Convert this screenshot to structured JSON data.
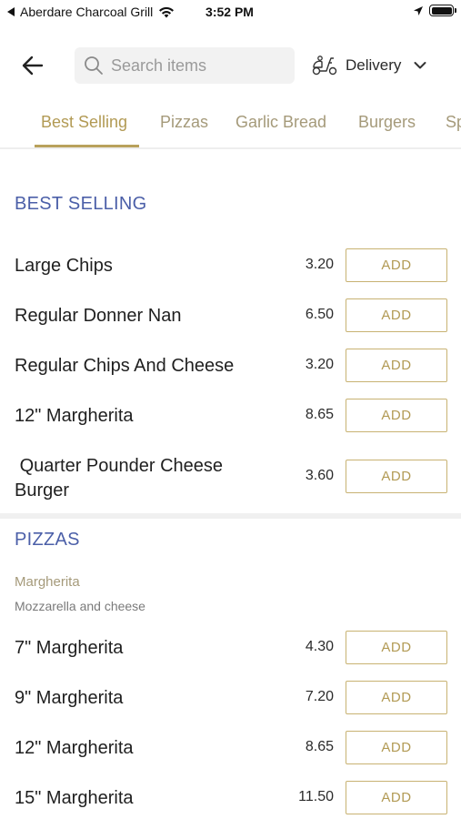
{
  "status_bar": {
    "carrier": "Aberdare Charcoal Grill",
    "time": "3:52 PM"
  },
  "header": {
    "search_placeholder": "Search items",
    "delivery_label": "Delivery"
  },
  "tabs": [
    {
      "label": "Best Selling",
      "active": true
    },
    {
      "label": "Pizzas"
    },
    {
      "label": "Garlic Bread"
    },
    {
      "label": "Burgers"
    },
    {
      "label": "Sp"
    }
  ],
  "sections": [
    {
      "title": "BEST SELLING",
      "items": [
        {
          "name": "Large Chips",
          "price": "3.20",
          "button": "ADD"
        },
        {
          "name": "Regular Donner Nan",
          "price": "6.50",
          "button": "ADD"
        },
        {
          "name": "Regular Chips And Cheese",
          "price": "3.20",
          "button": "ADD"
        },
        {
          "name": "12\" Margherita",
          "price": "8.65",
          "button": "ADD"
        },
        {
          "name": " Quarter Pounder Cheese Burger",
          "price": "3.60",
          "button": "ADD"
        }
      ]
    },
    {
      "title": "PIZZAS",
      "subheading": "Margherita",
      "description": "Mozzarella and cheese",
      "items": [
        {
          "name": "7\" Margherita",
          "price": "4.30",
          "button": "ADD"
        },
        {
          "name": "9\" Margherita",
          "price": "7.20",
          "button": "ADD"
        },
        {
          "name": "12\" Margherita",
          "price": "8.65",
          "button": "ADD"
        },
        {
          "name": "15\" Margherita",
          "price": "11.50",
          "button": "ADD"
        }
      ]
    }
  ],
  "colors": {
    "accent_gold": "#b29a54",
    "section_blue": "#4b5fa8"
  }
}
